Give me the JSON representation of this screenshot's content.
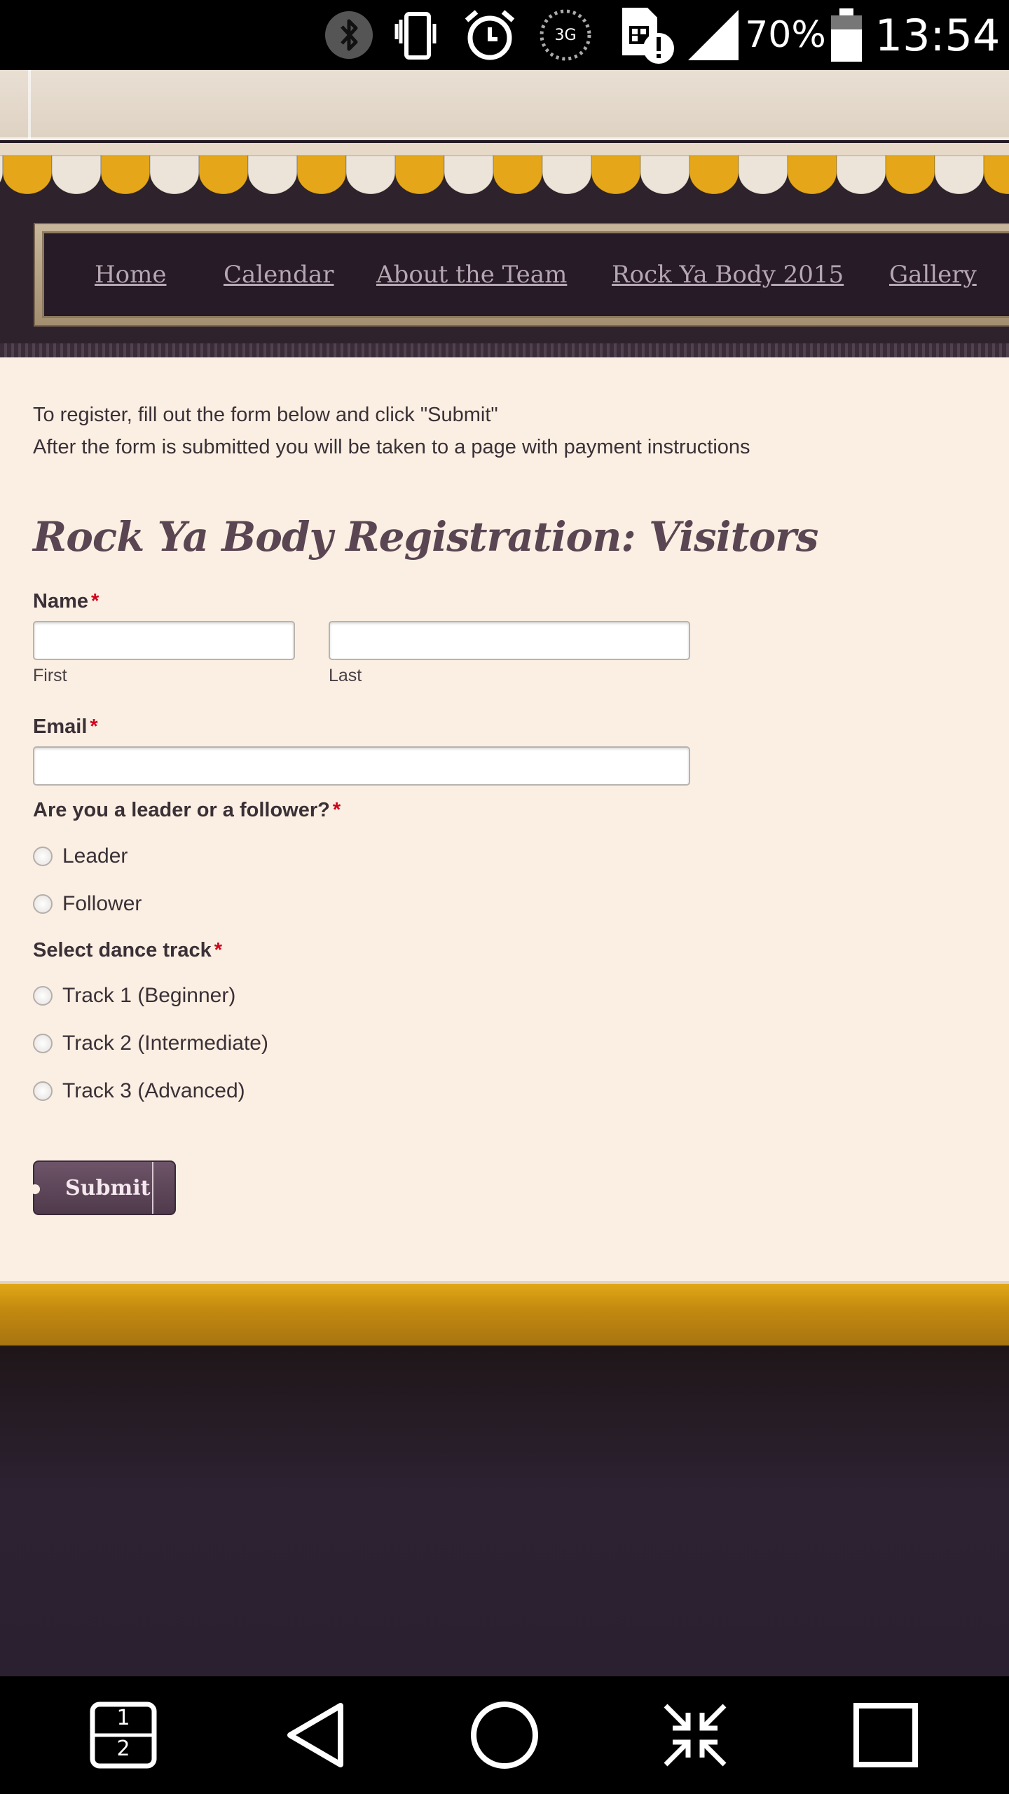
{
  "status_bar": {
    "battery_percent": "70%",
    "time": "13:54",
    "network_label": "3G",
    "icons": [
      "bluetooth-icon",
      "vibrate-icon",
      "alarm-icon",
      "3g-icon",
      "sim-alert-icon",
      "signal-icon",
      "battery-icon"
    ]
  },
  "nav": {
    "items": [
      {
        "label": "Home"
      },
      {
        "label": "Calendar"
      },
      {
        "label": "About the Team"
      },
      {
        "label": "Rock Ya Body 2015"
      },
      {
        "label": "Gallery"
      }
    ]
  },
  "content": {
    "intro_line1": "To register, fill out the form below and click \"Submit\"",
    "intro_line2": "After the form is submitted you will be taken to a page with payment instructions",
    "form_title": "Rock Ya Body Registration: Visitors",
    "required_marker": "*",
    "name": {
      "label": "Name",
      "first_value": "",
      "first_sublabel": "First",
      "last_value": "",
      "last_sublabel": "Last"
    },
    "email": {
      "label": "Email",
      "value": ""
    },
    "role": {
      "label": "Are you a leader or a follower?",
      "options": [
        {
          "label": "Leader",
          "checked": false
        },
        {
          "label": "Follower",
          "checked": false
        }
      ]
    },
    "track": {
      "label": "Select dance track",
      "options": [
        {
          "label": "Track 1 (Beginner)",
          "checked": false
        },
        {
          "label": "Track 2 (Intermediate)",
          "checked": false
        },
        {
          "label": "Track 3 (Advanced)",
          "checked": false
        }
      ]
    },
    "submit_label": "Submit"
  },
  "colors": {
    "awning_gold": "#e5a719",
    "awning_cream": "#ece4d8",
    "page_background": "#fbefe3",
    "heading": "#5a4552",
    "required": "#d0021b",
    "button": "#5e4659",
    "footer_band": "#c48a10",
    "dark_bg": "#2a2030"
  },
  "system_nav": {
    "icons": [
      "multiwindow-icon",
      "back-icon",
      "home-icon",
      "collapse-icon",
      "recents-icon"
    ],
    "multiwindow_top": "1",
    "multiwindow_bottom": "2"
  }
}
